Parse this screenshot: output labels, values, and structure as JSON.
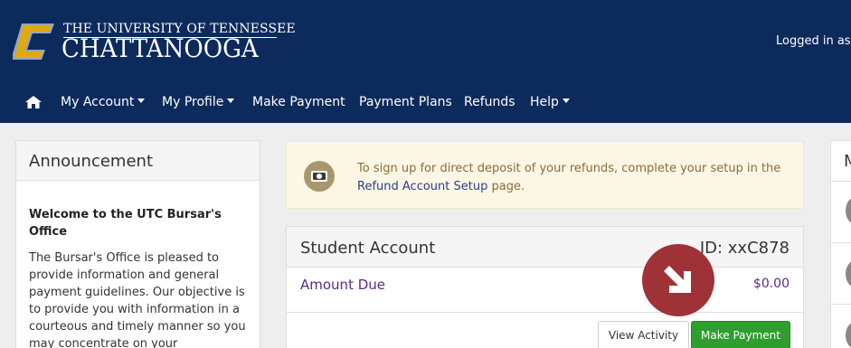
{
  "header": {
    "university_line1": "THE UNIVERSITY OF TENNESSEE",
    "university_line2": "CHATTANOOGA",
    "logged_in_text": "Logged in as",
    "brand_colors": {
      "navy": "#0d2a5c",
      "gold": "#e0aa0f",
      "silver": "#9aa5b8"
    }
  },
  "nav": {
    "home_icon": "home-icon",
    "items": [
      {
        "label": "My Account",
        "dropdown": true
      },
      {
        "label": "My Profile",
        "dropdown": true
      },
      {
        "label": "Make Payment",
        "dropdown": false
      },
      {
        "label": "Payment Plans",
        "dropdown": false
      },
      {
        "label": "Refunds",
        "dropdown": false
      },
      {
        "label": "Help",
        "dropdown": true
      }
    ]
  },
  "announcement": {
    "title": "Announcement",
    "subtitle": "Welcome to the UTC Bursar's Office",
    "body": "The Bursar's Office is pleased to provide information and general payment guidelines. Our objective is to provide you with information in a courteous and timely manner so you may concentrate on your"
  },
  "notice": {
    "icon": "money-icon",
    "text_before": "To sign up for direct deposit of your refunds, complete your setup in the ",
    "link": "Refund Account Setup",
    "text_after": " page.",
    "color": "#8a6d3b"
  },
  "student_account": {
    "title": "Student Account",
    "id": "ID: xxC878",
    "amount_label": "Amount Due",
    "amount_value": "$0.00",
    "view_activity": "View Activity",
    "make_payment": "Make Payment",
    "accent": "#2e9e2e"
  },
  "callout": {
    "icon": "arrow-down-right-icon",
    "color": "#9f3237"
  },
  "right_panel": {
    "title_fragment": "M"
  }
}
